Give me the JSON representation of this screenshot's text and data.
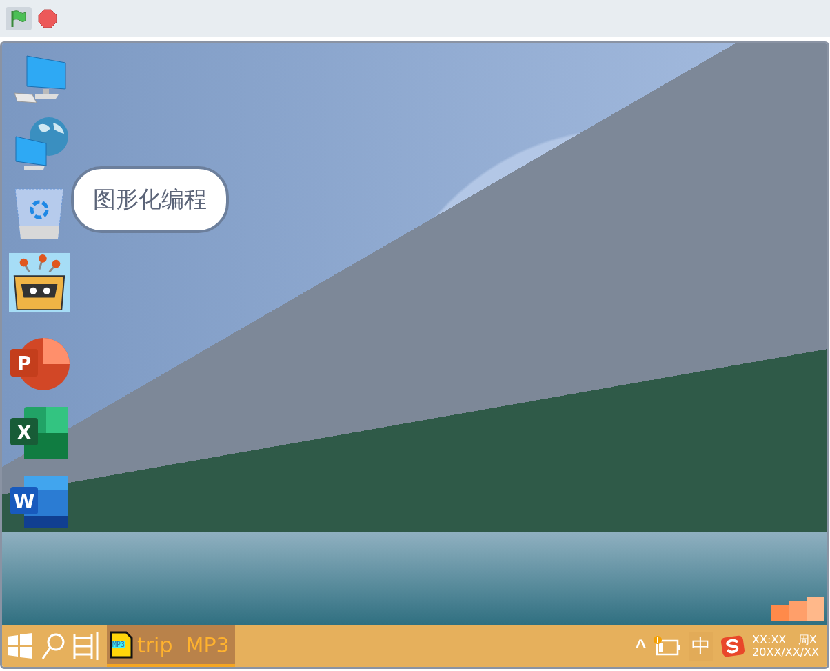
{
  "toolbar": {
    "green_flag": {
      "selected": true
    }
  },
  "desktop": {
    "icons": [
      {
        "kind": "computer"
      },
      {
        "kind": "network"
      },
      {
        "kind": "recycle_bin"
      },
      {
        "kind": "robot"
      },
      {
        "kind": "powerpoint",
        "letter": "P"
      },
      {
        "kind": "excel",
        "letter": "X"
      },
      {
        "kind": "word",
        "letter": "W"
      }
    ],
    "speech_bubble": {
      "text": "图形化编程"
    }
  },
  "taskbar": {
    "app": {
      "icon_text": "MP3",
      "label": "trip  MP3",
      "active": true
    },
    "tray": {
      "caret": "^",
      "battery_warning": true,
      "input_method": "中",
      "time": "XX:XX",
      "weekday": "周X",
      "date": "20XX/XX/XX"
    }
  }
}
